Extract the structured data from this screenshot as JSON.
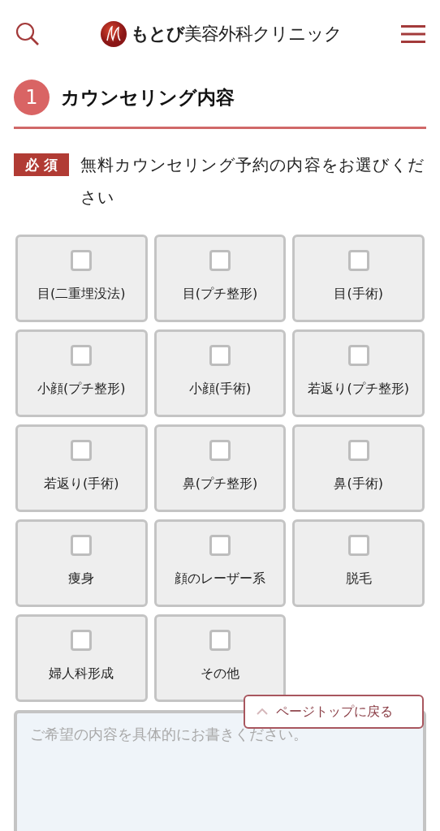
{
  "header": {
    "logo": "**もとび**美容外科クリニック"
  },
  "section": {
    "number": "1",
    "title": "カウンセリング内容"
  },
  "question": {
    "badge": "必 須",
    "text": "無料カウンセリング予約の内容をお選びください"
  },
  "options": [
    {
      "label": "目(二重埋没法)",
      "checked": false
    },
    {
      "label": "目(プチ整形)",
      "checked": false
    },
    {
      "label": "目(手術)",
      "checked": false
    },
    {
      "label": "小顔(プチ整形)",
      "checked": false
    },
    {
      "label": "小顔(手術)",
      "checked": false
    },
    {
      "label": "若返り(プチ整形)",
      "checked": false
    },
    {
      "label": "若返り(手術)",
      "checked": false
    },
    {
      "label": "鼻(プチ整形)",
      "checked": false
    },
    {
      "label": "鼻(手術)",
      "checked": false
    },
    {
      "label": "痩身",
      "checked": false
    },
    {
      "label": "顔のレーザー系",
      "checked": false
    },
    {
      "label": "脱毛",
      "checked": false
    },
    {
      "label": "婦人科形成",
      "checked": false
    },
    {
      "label": "その他",
      "checked": false
    }
  ],
  "details": {
    "placeholder": "ご希望の内容を具体的にお書きください。"
  },
  "page_top": {
    "label": "ページトップに戻る"
  }
}
